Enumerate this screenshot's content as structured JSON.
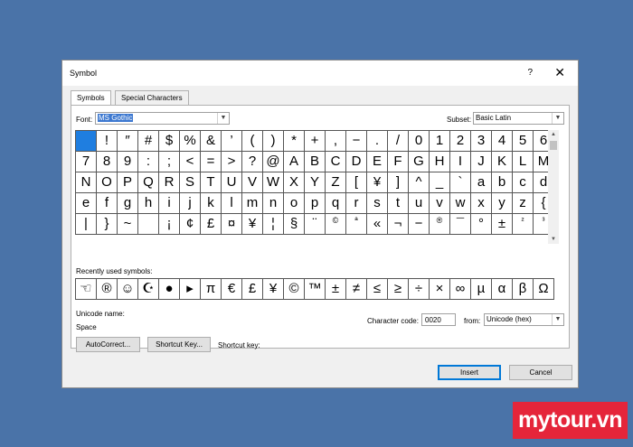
{
  "window": {
    "title": "Symbol",
    "help": "?",
    "close": "✕"
  },
  "tabs": [
    {
      "label": "Symbols"
    },
    {
      "label": "Special Characters"
    }
  ],
  "font": {
    "label": "Font:",
    "value": "MS Gothic"
  },
  "subset": {
    "label": "Subset:",
    "value": "Basic Latin"
  },
  "grid": [
    [
      "",
      "!",
      "″",
      "#",
      "$",
      "%",
      "&",
      "’",
      "(",
      ")",
      "*",
      "+",
      ",",
      "−",
      ".",
      "/",
      "0",
      "1",
      "2",
      "3",
      "4",
      "5",
      "6"
    ],
    [
      "7",
      "8",
      "9",
      ":",
      ";",
      "<",
      "=",
      ">",
      "?",
      "@",
      "A",
      "B",
      "C",
      "D",
      "E",
      "F",
      "G",
      "H",
      "I",
      "J",
      "K",
      "L",
      "M"
    ],
    [
      "N",
      "O",
      "P",
      "Q",
      "R",
      "S",
      "T",
      "U",
      "V",
      "W",
      "X",
      "Y",
      "Z",
      "[",
      "¥",
      "]",
      "^",
      "_",
      "`",
      "a",
      "b",
      "c",
      "d"
    ],
    [
      "e",
      "f",
      "g",
      "h",
      "i",
      "j",
      "k",
      "l",
      "m",
      "n",
      "o",
      "p",
      "q",
      "r",
      "s",
      "t",
      "u",
      "v",
      "w",
      "x",
      "y",
      "z",
      "{"
    ],
    [
      "|",
      "}",
      "~",
      "",
      "¡",
      "¢",
      "£",
      "¤",
      "¥",
      "¦",
      "§",
      "¨",
      "©",
      "ª",
      "«",
      "¬",
      "−",
      "®",
      "¯",
      "°",
      "±",
      "²",
      "³"
    ]
  ],
  "recent": {
    "label": "Recently used symbols:",
    "items": [
      "☜",
      "®",
      "☺",
      "☪",
      "●",
      "▸",
      "π",
      "€",
      "£",
      "¥",
      "©",
      "™",
      "±",
      "≠",
      "≤",
      "≥",
      "÷",
      "×",
      "∞",
      "µ",
      "α",
      "β",
      "Ω"
    ]
  },
  "unicode_name": {
    "label": "Unicode name:",
    "value": "Space"
  },
  "char_code": {
    "label": "Character code:",
    "value": "0020"
  },
  "from": {
    "label": "from:",
    "value": "Unicode (hex)"
  },
  "buttons": {
    "autocorrect": "AutoCorrect...",
    "shortcut_key": "Shortcut Key...",
    "shortcut_label": "Shortcut key:",
    "insert": "Insert",
    "cancel": "Cancel"
  },
  "brand": "mytour.vn",
  "colors": {
    "background": "#4a73a8",
    "selection": "#1f7ee0",
    "brand": "#e5253a"
  }
}
